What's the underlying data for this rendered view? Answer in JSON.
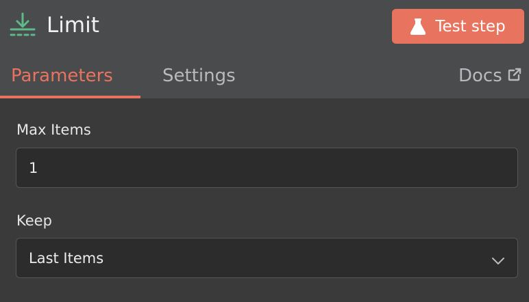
{
  "node": {
    "title": "Limit",
    "icon": "download-limit-icon",
    "icon_color": "#5fba8a"
  },
  "toolbar": {
    "test_label": "Test step",
    "test_icon": "flask-icon",
    "accent": "#e8735f"
  },
  "tabs": [
    {
      "label": "Parameters",
      "active": true
    },
    {
      "label": "Settings",
      "active": false
    }
  ],
  "docs": {
    "label": "Docs",
    "icon": "external-link-icon"
  },
  "fields": {
    "max_items": {
      "label": "Max Items",
      "value": "1"
    },
    "keep": {
      "label": "Keep",
      "value": "Last Items",
      "icon": "chevron-down-icon"
    }
  }
}
